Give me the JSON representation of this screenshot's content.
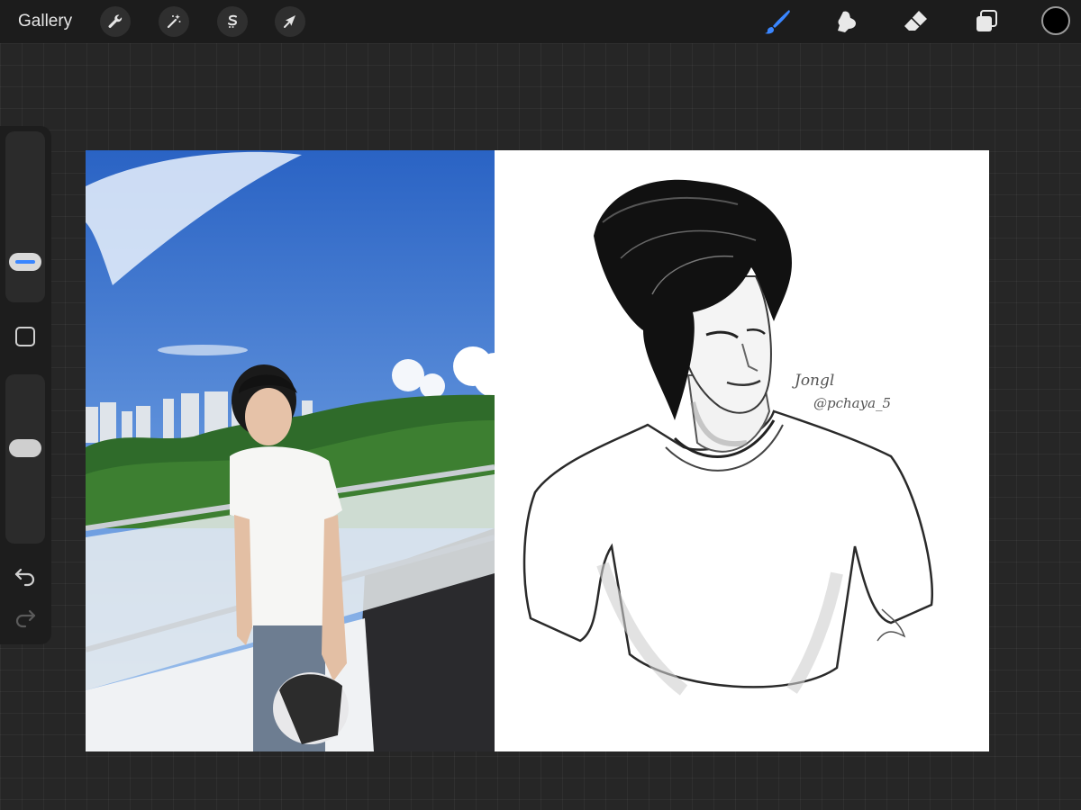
{
  "topbar": {
    "gallery_label": "Gallery",
    "left_tools": [
      "wrench-icon",
      "magic-wand-icon",
      "selection-icon",
      "transform-arrow-icon"
    ],
    "right_tools": [
      "brush-icon",
      "smudge-icon",
      "eraser-icon",
      "layers-icon"
    ],
    "active_tool": "brush-icon",
    "accent_color": "#3a86ff",
    "current_color": "#000000"
  },
  "sidebar": {
    "icons": [
      "size-slider",
      "modify-square-icon",
      "opacity-slider",
      "undo-icon",
      "redo-icon"
    ]
  },
  "canvas": {
    "signature": "Jongl",
    "handle": "@pchaya_5"
  }
}
